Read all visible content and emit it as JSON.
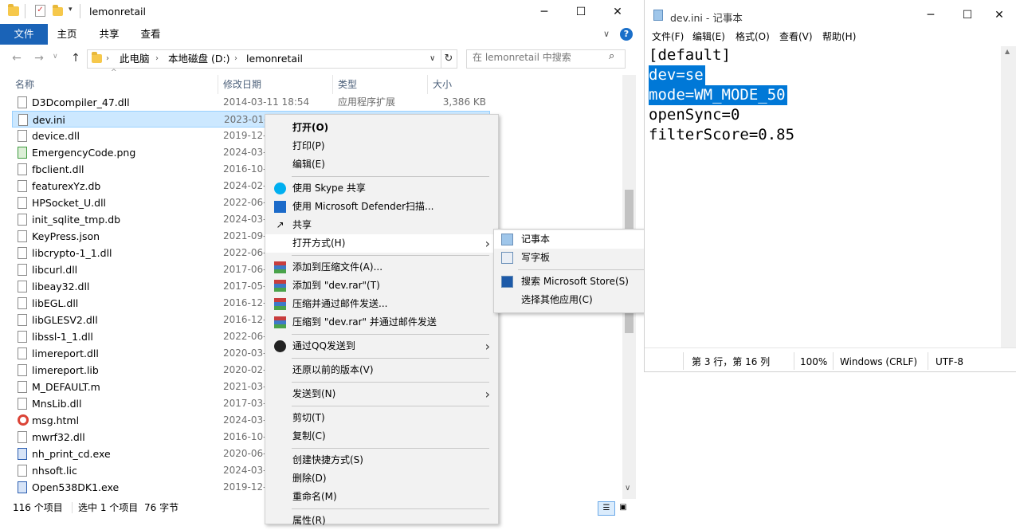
{
  "explorer": {
    "title": "lemonretail",
    "ribbon_tabs": [
      "文件",
      "主页",
      "共享",
      "查看"
    ],
    "breadcrumb": [
      "此电脑",
      "本地磁盘 (D:)",
      "lemonretail"
    ],
    "search_placeholder": "在 lemonretail 中搜索",
    "columns": {
      "name": "名称",
      "date": "修改日期",
      "type": "类型",
      "size": "大小"
    },
    "files": [
      {
        "name": "D3Dcompiler_47.dll",
        "date": "2014-03-11 18:54",
        "type": "应用程序扩展",
        "size": "3,386 KB",
        "icon": "dll-icon"
      },
      {
        "name": "dev.ini",
        "date": "2023-01-",
        "type": "",
        "size": "",
        "icon": "ini-icon"
      },
      {
        "name": "device.dll",
        "date": "2019-12-",
        "type": "",
        "size": "",
        "icon": "dll-icon"
      },
      {
        "name": "EmergencyCode.png",
        "date": "2024-03-",
        "type": "",
        "size": "",
        "icon": "png-icon"
      },
      {
        "name": "fbclient.dll",
        "date": "2016-10-",
        "type": "",
        "size": "",
        "icon": "dll-icon"
      },
      {
        "name": "featurexYz.db",
        "date": "2024-02-",
        "type": "",
        "size": "",
        "icon": "db-icon"
      },
      {
        "name": "HPSocket_U.dll",
        "date": "2022-06-",
        "type": "",
        "size": "",
        "icon": "dll-icon"
      },
      {
        "name": "init_sqlite_tmp.db",
        "date": "2024-03-",
        "type": "",
        "size": "",
        "icon": "db-icon"
      },
      {
        "name": "KeyPress.json",
        "date": "2021-09-",
        "type": "",
        "size": "",
        "icon": "file-icon"
      },
      {
        "name": "libcrypto-1_1.dll",
        "date": "2022-06-",
        "type": "",
        "size": "",
        "icon": "dll-icon"
      },
      {
        "name": "libcurl.dll",
        "date": "2017-06-",
        "type": "",
        "size": "",
        "icon": "dll-icon"
      },
      {
        "name": "libeay32.dll",
        "date": "2017-05-",
        "type": "",
        "size": "",
        "icon": "dll-icon"
      },
      {
        "name": "libEGL.dll",
        "date": "2016-12-",
        "type": "",
        "size": "",
        "icon": "dll-icon"
      },
      {
        "name": "libGLESV2.dll",
        "date": "2016-12-",
        "type": "",
        "size": "",
        "icon": "dll-icon"
      },
      {
        "name": "libssl-1_1.dll",
        "date": "2022-06-",
        "type": "",
        "size": "",
        "icon": "dll-icon"
      },
      {
        "name": "limereport.dll",
        "date": "2020-03-",
        "type": "",
        "size": "",
        "icon": "dll-icon"
      },
      {
        "name": "limereport.lib",
        "date": "2020-02-",
        "type": "",
        "size": "",
        "icon": "file-icon"
      },
      {
        "name": "M_DEFAULT.m",
        "date": "2021-03-",
        "type": "",
        "size": "",
        "icon": "file-icon"
      },
      {
        "name": "MnsLib.dll",
        "date": "2017-03-",
        "type": "",
        "size": "",
        "icon": "dll-icon"
      },
      {
        "name": "msg.html",
        "date": "2024-03-",
        "type": "",
        "size": "",
        "icon": "chrome-icon"
      },
      {
        "name": "mwrf32.dll",
        "date": "2016-10-",
        "type": "",
        "size": "",
        "icon": "dll-icon"
      },
      {
        "name": "nh_print_cd.exe",
        "date": "2020-06-",
        "type": "",
        "size": "",
        "icon": "exe-icon"
      },
      {
        "name": "nhsoft.lic",
        "date": "2024-03-",
        "type": "",
        "size": "",
        "icon": "file-icon"
      },
      {
        "name": "Open538DK1.exe",
        "date": "2019-12-",
        "type": "",
        "size": "",
        "icon": "exe-icon"
      }
    ],
    "status": {
      "count": "116 个项目",
      "selection": "选中 1 个项目",
      "size": "76 字节"
    }
  },
  "context_menu": {
    "items": [
      {
        "label": "打开(O)",
        "icon": "",
        "bold": true
      },
      {
        "label": "打印(P)",
        "icon": ""
      },
      {
        "label": "编辑(E)",
        "icon": ""
      },
      {
        "label": "使用 Skype 共享",
        "icon": "skype-icon"
      },
      {
        "label": "使用 Microsoft Defender扫描...",
        "icon": "defender-icon"
      },
      {
        "label": "共享",
        "icon": "share-icon"
      },
      {
        "label": "打开方式(H)",
        "icon": "",
        "submenu": true
      },
      {
        "label": "添加到压缩文件(A)...",
        "icon": "winrar-icon"
      },
      {
        "label": "添加到 \"dev.rar\"(T)",
        "icon": "winrar-icon"
      },
      {
        "label": "压缩并通过邮件发送...",
        "icon": "winrar-icon"
      },
      {
        "label": "压缩到 \"dev.rar\" 并通过邮件发送",
        "icon": "winrar-icon"
      },
      {
        "label": "通过QQ发送到",
        "icon": "qq-icon",
        "submenu": true
      },
      {
        "label": "还原以前的版本(V)",
        "icon": ""
      },
      {
        "label": "发送到(N)",
        "icon": "",
        "submenu": true
      },
      {
        "label": "剪切(T)",
        "icon": ""
      },
      {
        "label": "复制(C)",
        "icon": ""
      },
      {
        "label": "创建快捷方式(S)",
        "icon": ""
      },
      {
        "label": "删除(D)",
        "icon": ""
      },
      {
        "label": "重命名(M)",
        "icon": ""
      },
      {
        "label": "属性(R)",
        "icon": ""
      }
    ]
  },
  "open_with_menu": {
    "items": [
      {
        "label": "记事本",
        "icon": "notepad-icon"
      },
      {
        "label": "写字板",
        "icon": "wordpad-icon"
      },
      {
        "label": "搜索 Microsoft Store(S)",
        "icon": "store-icon"
      },
      {
        "label": "选择其他应用(C)",
        "icon": ""
      }
    ]
  },
  "notepad": {
    "title": "dev.ini - 记事本",
    "menu": [
      "文件(F)",
      "编辑(E)",
      "格式(O)",
      "查看(V)",
      "帮助(H)"
    ],
    "lines": [
      "[default]",
      "dev=se",
      "mode=WM_MODE_50",
      "openSync=0",
      "filterScore=0.85"
    ],
    "status": {
      "position": "第 3 行，第 16 列",
      "zoom": "100%",
      "eol": "Windows (CRLF)",
      "encoding": "UTF-8"
    }
  },
  "colors": {
    "accent": "#0078d7",
    "ribbon_file": "#1a63b7",
    "selection": "#cce8ff",
    "menu_bg": "#f2f2f2"
  }
}
